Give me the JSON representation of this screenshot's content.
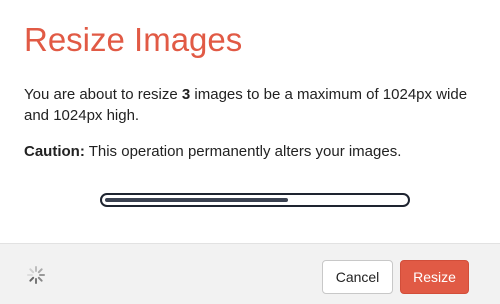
{
  "dialog": {
    "title": "Resize Images",
    "message": {
      "prefix": "You are about to resize ",
      "count": "3",
      "suffix": " images to be a maximum of 1024px wide and 1024px high."
    },
    "caution": {
      "label": "Caution:",
      "text": " This operation permanently alters your images."
    },
    "progress": {
      "fraction": 0.61
    },
    "footer": {
      "cancel_label": "Cancel",
      "resize_label": "Resize",
      "spinner_icon": "loading-spinner-icon"
    },
    "colors": {
      "accent": "#e15a45",
      "text": "#222222",
      "footer_bg": "#f2f2f2",
      "progress_border": "#1e2430"
    }
  }
}
